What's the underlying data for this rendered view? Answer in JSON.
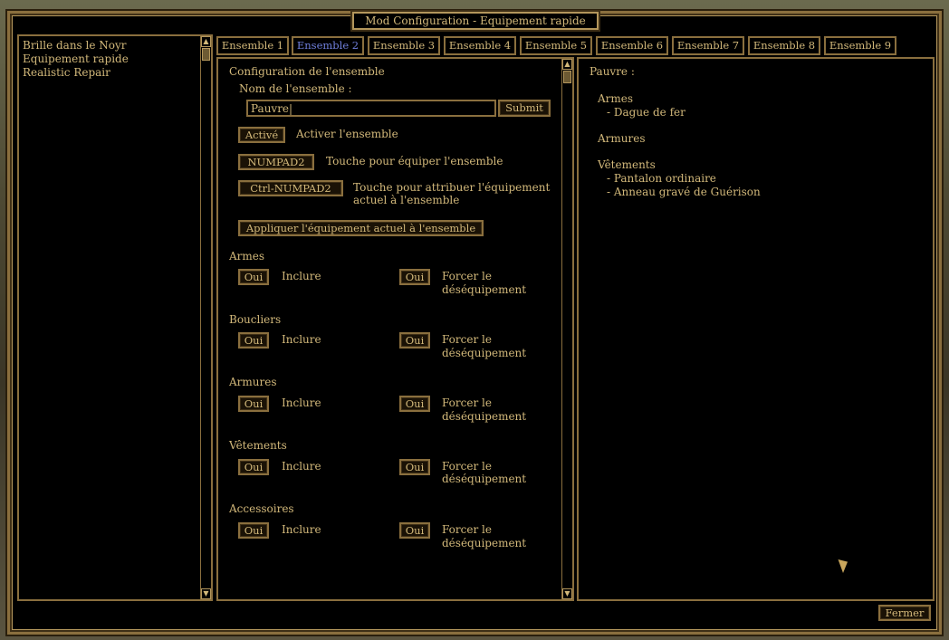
{
  "window": {
    "title": "Mod Configuration - Equipement rapide"
  },
  "mod_list": [
    "Brille dans le Noyr",
    "Equipement rapide",
    "Realistic Repair"
  ],
  "tabs": [
    "Ensemble 1",
    "Ensemble 2",
    "Ensemble 3",
    "Ensemble 4",
    "Ensemble 5",
    "Ensemble 6",
    "Ensemble 7",
    "Ensemble 8",
    "Ensemble 9"
  ],
  "active_tab": "Ensemble 2",
  "config": {
    "heading": "Configuration de l'ensemble",
    "name_label": "Nom de l'ensemble :",
    "name_value": "Pauvre|",
    "submit_label": "Submit",
    "active_button": "Activé",
    "active_label": "Activer l'ensemble",
    "equip_key": "NUMPAD2",
    "equip_key_label": "Touche pour équiper l'ensemble",
    "assign_key": "Ctrl-NUMPAD2",
    "assign_key_label_1": "Touche pour attribuer l'équipement",
    "assign_key_label_2": "actuel à l'ensemble",
    "apply_button": "Appliquer l'équipement actuel à l'ensemble"
  },
  "categories": [
    {
      "name": "Armes",
      "include_value": "Oui",
      "include_label": "Inclure",
      "force_value": "Oui",
      "force_label_1": "Forcer le",
      "force_label_2": "déséquipement"
    },
    {
      "name": "Boucliers",
      "include_value": "Oui",
      "include_label": "Inclure",
      "force_value": "Oui",
      "force_label_1": "Forcer le",
      "force_label_2": "déséquipement"
    },
    {
      "name": "Armures",
      "include_value": "Oui",
      "include_label": "Inclure",
      "force_value": "Oui",
      "force_label_1": "Forcer le",
      "force_label_2": "déséquipement"
    },
    {
      "name": "Vêtements",
      "include_value": "Oui",
      "include_label": "Inclure",
      "force_value": "Oui",
      "force_label_1": "Forcer le",
      "force_label_2": "déséquipement"
    },
    {
      "name": "Accessoires",
      "include_value": "Oui",
      "include_label": "Inclure",
      "force_value": "Oui",
      "force_label_1": "Forcer le",
      "force_label_2": "déséquipement"
    }
  ],
  "summary": {
    "title": "Pauvre :",
    "weapons_heading": "Armes",
    "weapons": [
      "- Dague de fer"
    ],
    "armor_heading": "Armures",
    "clothing_heading": "Vêtements",
    "clothing": [
      "- Pantalon ordinaire",
      "- Anneau gravé de Guérison"
    ]
  },
  "close_button": "Fermer",
  "colors": {
    "gold": "#d2b87a",
    "border": "#8a6f3e",
    "active_tab": "#6f7fdb",
    "background": "#000000"
  }
}
